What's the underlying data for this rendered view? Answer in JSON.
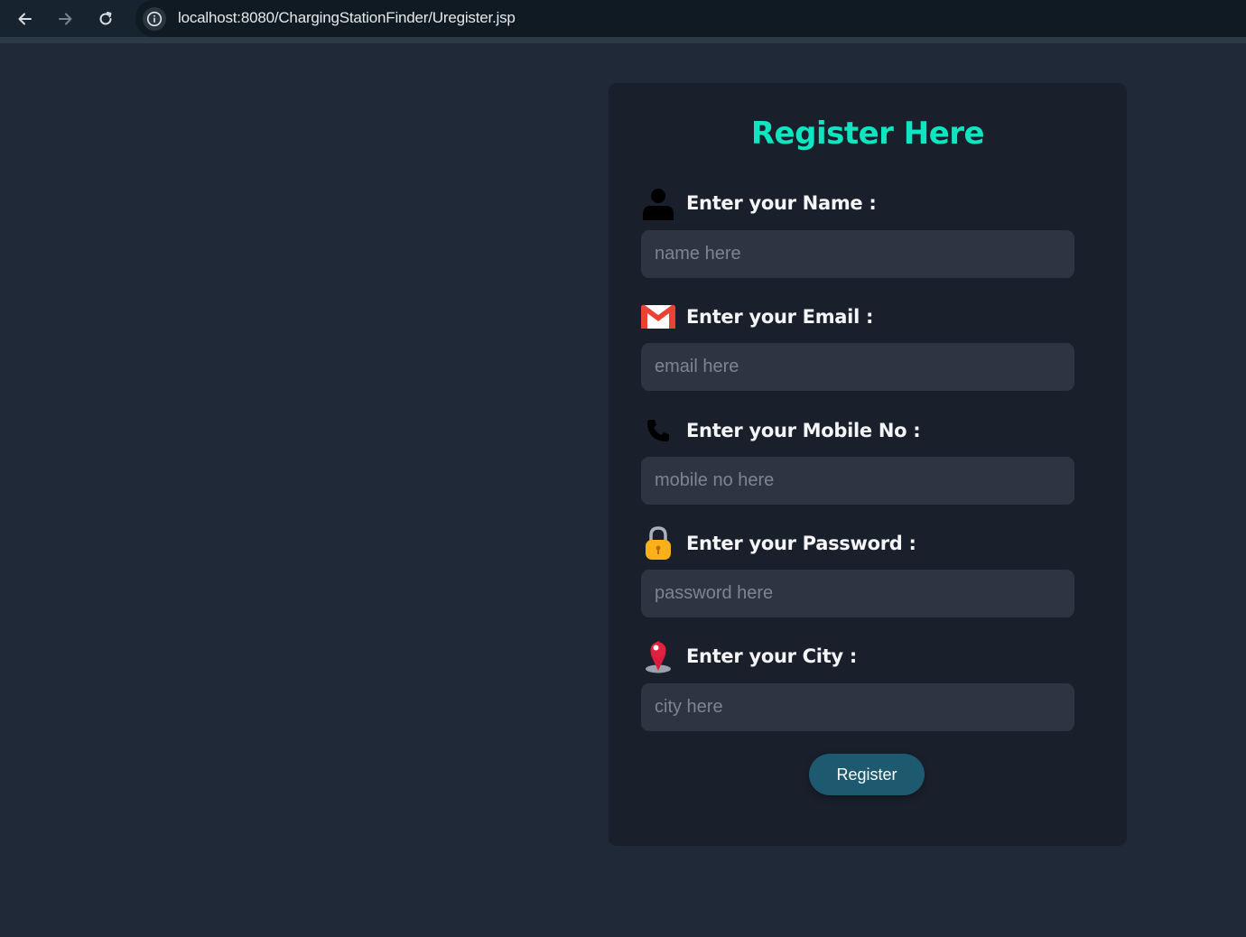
{
  "browser": {
    "url": "localhost:8080/ChargingStationFinder/Uregister.jsp",
    "icons": [
      "back-arrow-icon",
      "forward-arrow-icon",
      "reload-icon",
      "info-icon"
    ]
  },
  "form": {
    "title": "Register Here",
    "fields": [
      {
        "label": "Enter your Name :",
        "placeholder": "name here",
        "icon": "person-icon"
      },
      {
        "label": "Enter your Email :",
        "placeholder": "email here",
        "icon": "gmail-icon"
      },
      {
        "label": "Enter your Mobile No :",
        "placeholder": "mobile no here",
        "icon": "phone-icon"
      },
      {
        "label": "Enter your Password :",
        "placeholder": "password here",
        "icon": "lock-icon"
      },
      {
        "label": "Enter your City :",
        "placeholder": "city here",
        "icon": "location-pin-icon"
      }
    ],
    "submit_label": "Register"
  },
  "colors": {
    "page_bg": "#1f2937",
    "card_bg": "#1a202b",
    "title": "#0fe6c1",
    "input_bg": "#2d3542",
    "button_bg": "#1d5a70"
  }
}
